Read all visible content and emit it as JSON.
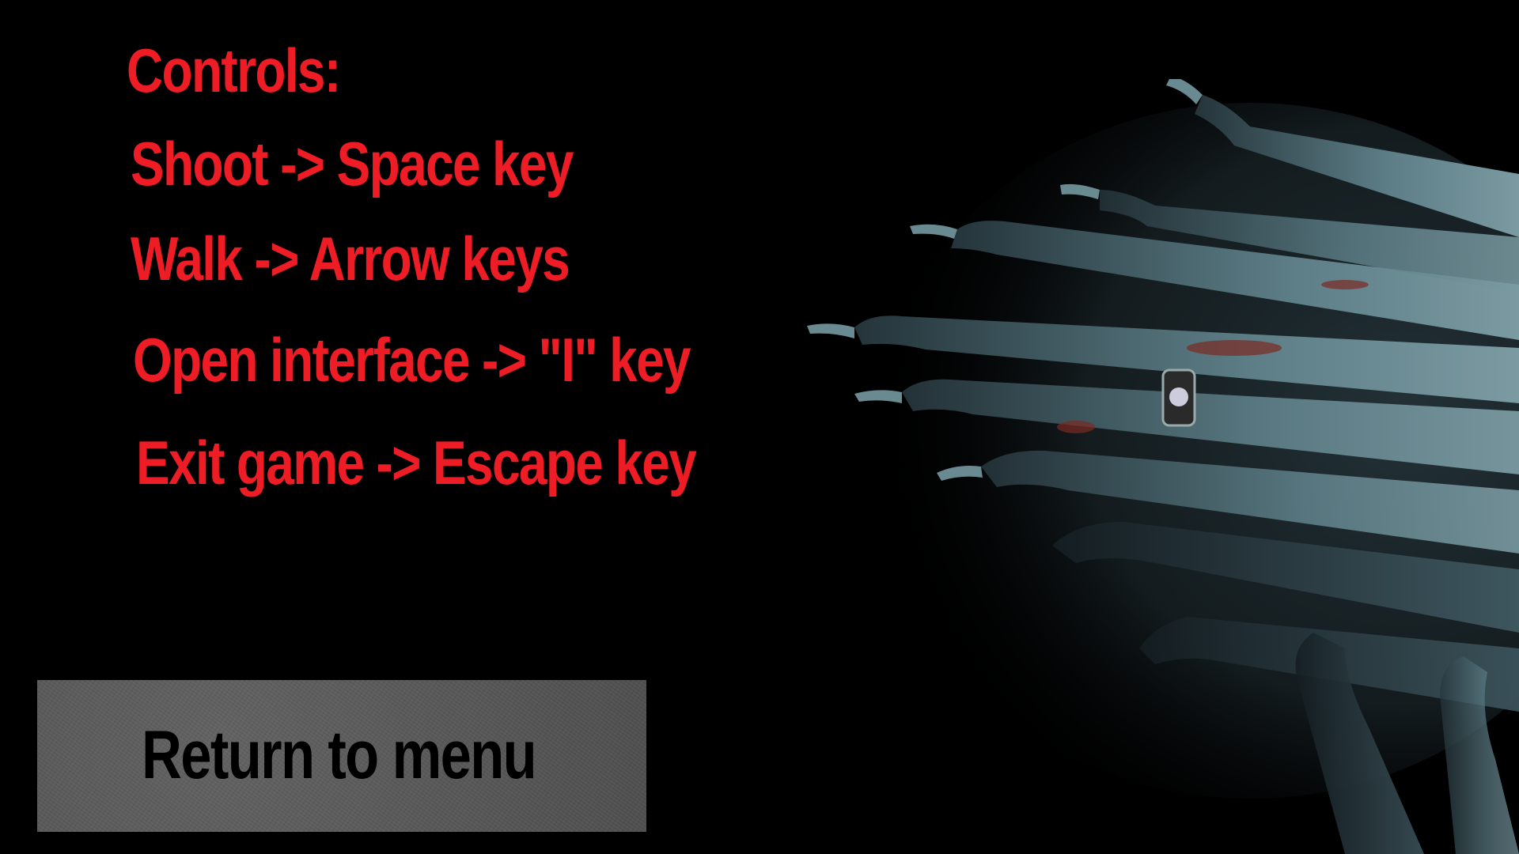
{
  "controls": {
    "heading": "Controls:",
    "lines": [
      "Shoot -> Space key",
      "Walk -> Arrow keys",
      "Open interface -> \"I\" key",
      "Exit game -> Escape key"
    ]
  },
  "menu_button": {
    "label": "Return to menu"
  },
  "background": {
    "image": "zombie-hands-illustration"
  },
  "colors": {
    "text_red": "#ee1c24",
    "button_gray": "#5a5a5a",
    "button_text": "#000000",
    "background": "#000000"
  }
}
